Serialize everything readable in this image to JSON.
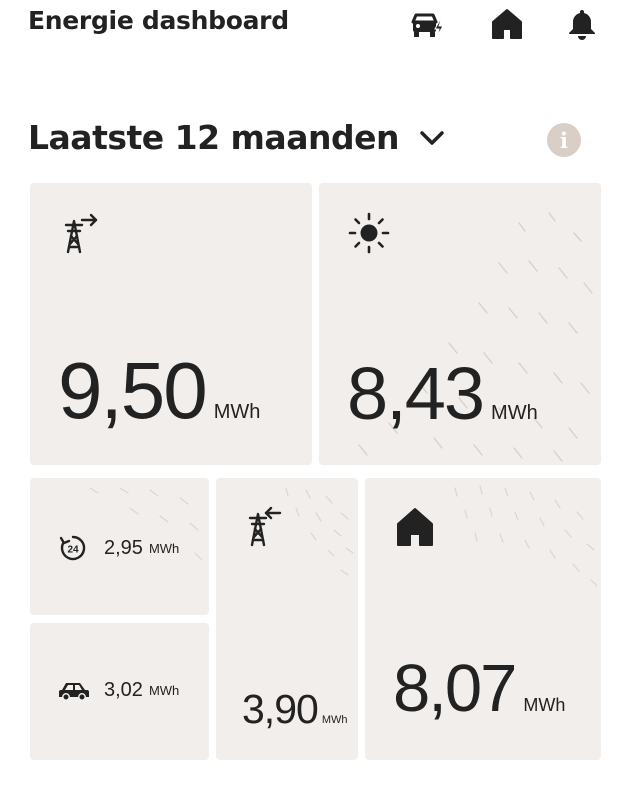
{
  "header": {
    "title": "Energie dashboard",
    "icons": [
      "car-charging-icon",
      "home-icon",
      "bell-icon"
    ]
  },
  "period": {
    "label": "Laatste 12 maanden"
  },
  "info": {
    "glyph": "i"
  },
  "tiles": {
    "grid_import": {
      "icon": "pylon-export-icon",
      "value": "9,50",
      "unit": "MWh"
    },
    "solar": {
      "icon": "sun-icon",
      "value": "8,43",
      "unit": "MWh"
    },
    "dynamic_24h": {
      "icon": "clock-24-icon",
      "value": "2,95",
      "unit": "MWh"
    },
    "car": {
      "icon": "car-icon",
      "value": "3,02",
      "unit": "MWh"
    },
    "grid_export": {
      "icon": "pylon-import-icon",
      "value": "3,90",
      "unit": "MWh"
    },
    "home": {
      "icon": "home-icon",
      "value": "8,07",
      "unit": "MWh"
    }
  },
  "colors": {
    "tile_bg": "#f2eeeb",
    "text": "#222222",
    "info_bg": "#d9cfc7"
  }
}
